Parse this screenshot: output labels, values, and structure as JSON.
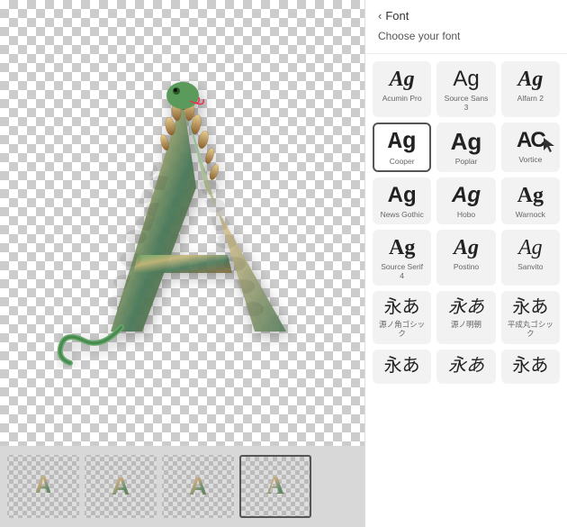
{
  "header": {
    "back_label": "Font",
    "section_label": "Choose your font"
  },
  "fonts": [
    {
      "id": "acumin-pro",
      "label": "Ag",
      "name": "Acumin Pro",
      "style_class": "font-acumin",
      "selected": false,
      "japanese": false
    },
    {
      "id": "source-sans-3",
      "label": "Ag",
      "name": "Source Sans 3",
      "style_class": "font-sourcesans",
      "selected": false,
      "japanese": false
    },
    {
      "id": "alfarn-2",
      "label": "Ag",
      "name": "Alfarn 2",
      "style_class": "font-alfarn",
      "selected": false,
      "japanese": false
    },
    {
      "id": "cooper",
      "label": "Ag",
      "name": "Cooper",
      "style_class": "font-cooper",
      "selected": true,
      "japanese": false
    },
    {
      "id": "poplar",
      "label": "Ag",
      "name": "Poplar",
      "style_class": "font-poplar",
      "selected": false,
      "japanese": false
    },
    {
      "id": "vortice",
      "label": "AC",
      "name": "Vortice",
      "style_class": "font-vortice",
      "selected": false,
      "japanese": false
    },
    {
      "id": "news-gothic",
      "label": "Ag",
      "name": "News Gothic",
      "style_class": "font-newsgothic",
      "selected": false,
      "japanese": false
    },
    {
      "id": "hobo",
      "label": "Ag",
      "name": "Hobo",
      "style_class": "font-hobo",
      "selected": false,
      "japanese": false
    },
    {
      "id": "warnock",
      "label": "Ag",
      "name": "Warnock",
      "style_class": "font-warnock",
      "selected": false,
      "japanese": false
    },
    {
      "id": "source-serif-4",
      "label": "Ag",
      "name": "Source Serif 4",
      "style_class": "font-sourceserif",
      "selected": false,
      "japanese": false
    },
    {
      "id": "postino",
      "label": "Ag",
      "name": "Postino",
      "style_class": "font-postino",
      "selected": false,
      "japanese": false
    },
    {
      "id": "sanvito",
      "label": "Ag",
      "name": "Sanvito",
      "style_class": "font-sanvito",
      "selected": false,
      "japanese": false
    },
    {
      "id": "genyo-kaku-gothic",
      "label": "永あ",
      "name": "源ノ角ゴシック",
      "style_class": "",
      "selected": false,
      "japanese": true
    },
    {
      "id": "genmyo",
      "label": "永あ",
      "name": "源ノ明朝",
      "style_class": "",
      "selected": false,
      "japanese": true
    },
    {
      "id": "heisei-maru",
      "label": "永あ",
      "name": "平成丸ゴシック",
      "style_class": "",
      "selected": false,
      "japanese": true
    },
    {
      "id": "jp-font-4",
      "label": "永あ",
      "name": "",
      "style_class": "",
      "selected": false,
      "japanese": true
    },
    {
      "id": "jp-font-5",
      "label": "永あ",
      "name": "",
      "style_class": "",
      "selected": false,
      "japanese": true
    },
    {
      "id": "jp-font-6",
      "label": "永あ",
      "name": "",
      "style_class": "",
      "selected": false,
      "japanese": true
    }
  ],
  "thumbnails": [
    {
      "id": "thumb-1",
      "letter": "A",
      "selected": false
    },
    {
      "id": "thumb-2",
      "letter": "A",
      "selected": false
    },
    {
      "id": "thumb-3",
      "letter": "A",
      "selected": false
    },
    {
      "id": "thumb-4",
      "letter": "A",
      "selected": true
    }
  ]
}
